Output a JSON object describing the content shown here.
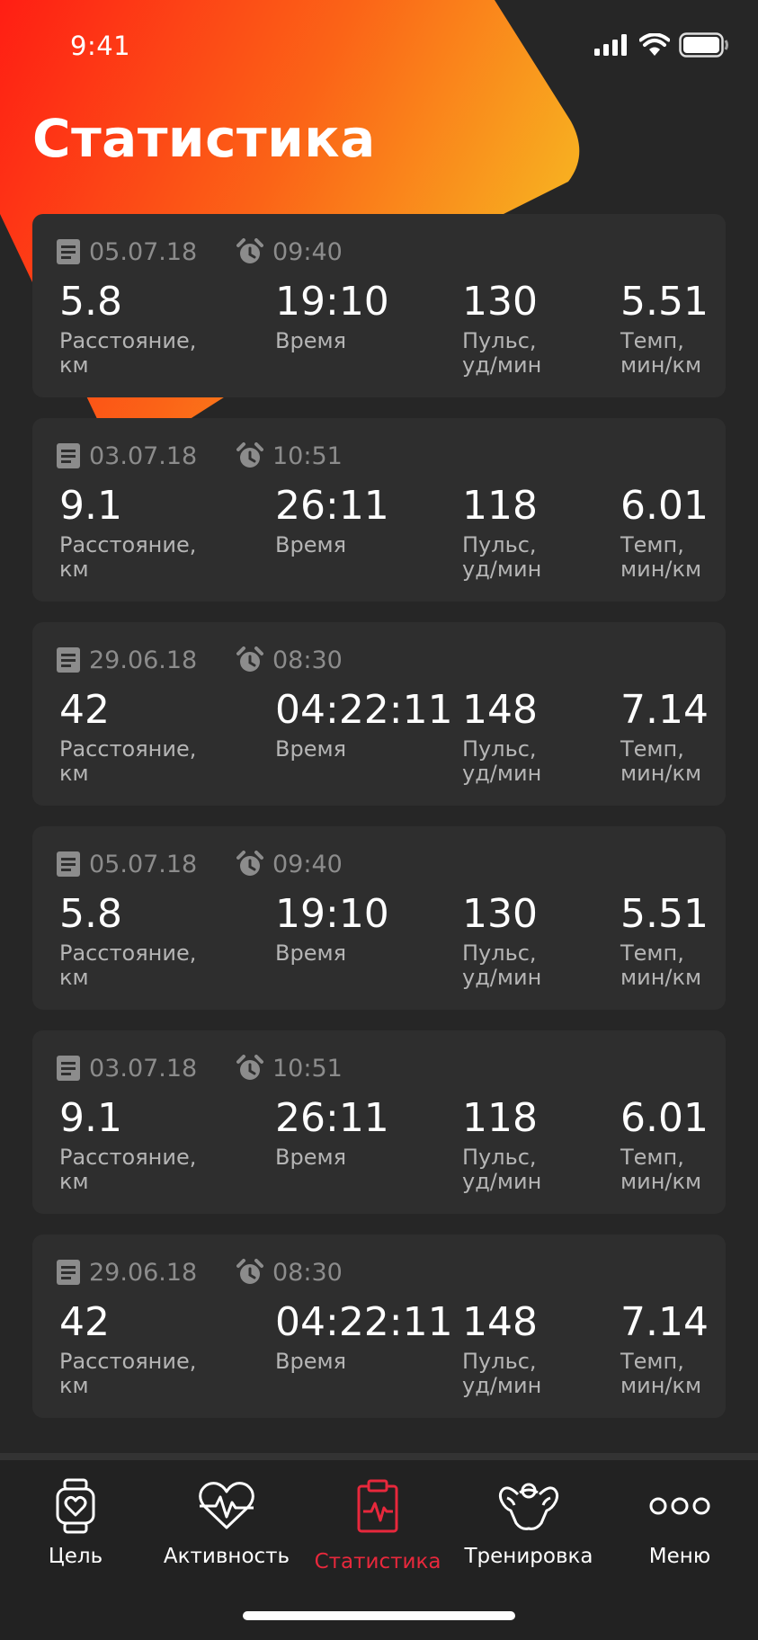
{
  "status_bar": {
    "time": "9:41"
  },
  "title": "Статистика",
  "colors": {
    "gradient_start": "#ff1e14",
    "gradient_end": "#f8ad20",
    "accent": "#e8283c",
    "card": "#2e2e2e",
    "background": "#262626"
  },
  "workouts": [
    {
      "date": "05.07.18",
      "time": "09:40",
      "distance": "5.8",
      "duration": "19:10",
      "pulse": "130",
      "pace": "5.51"
    },
    {
      "date": "03.07.18",
      "time": "10:51",
      "distance": "9.1",
      "duration": "26:11",
      "pulse": "118",
      "pace": "6.01"
    },
    {
      "date": "29.06.18",
      "time": "08:30",
      "distance": "42",
      "duration": "04:22:11",
      "pulse": "148",
      "pace": "7.14"
    },
    {
      "date": "05.07.18",
      "time": "09:40",
      "distance": "5.8",
      "duration": "19:10",
      "pulse": "130",
      "pace": "5.51"
    },
    {
      "date": "03.07.18",
      "time": "10:51",
      "distance": "9.1",
      "duration": "26:11",
      "pulse": "118",
      "pace": "6.01"
    },
    {
      "date": "29.06.18",
      "time": "08:30",
      "distance": "42",
      "duration": "04:22:11",
      "pulse": "148",
      "pace": "7.14"
    }
  ],
  "labels": {
    "distance": "Расстояние,\nкм",
    "duration": "Время",
    "pulse": "Пульс,\nуд/мин",
    "pace": "Темп,\nмин/км"
  },
  "tabs": [
    {
      "label": "Цель",
      "icon": "watch-heart-icon",
      "active": false
    },
    {
      "label": "Активность",
      "icon": "heart-pulse-icon",
      "active": false
    },
    {
      "label": "Статистика",
      "icon": "clipboard-pulse-icon",
      "active": true
    },
    {
      "label": "Тренировка",
      "icon": "flexed-arms-icon",
      "active": false
    },
    {
      "label": "Меню",
      "icon": "more-dots-icon",
      "active": false
    }
  ]
}
